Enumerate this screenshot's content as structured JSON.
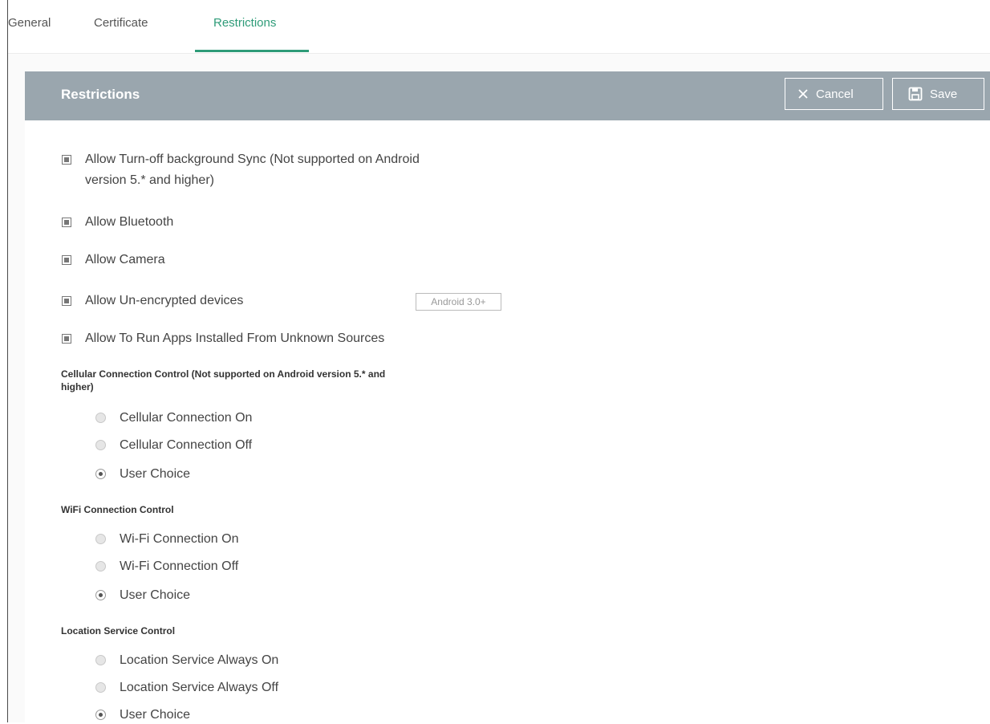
{
  "tabs": [
    {
      "label": "General"
    },
    {
      "label": "Certificate"
    },
    {
      "label": "Restrictions"
    }
  ],
  "panel": {
    "title": "Restrictions",
    "cancel_label": "Cancel",
    "save_label": "Save"
  },
  "checkboxes": [
    {
      "label_line1": "Allow Turn-off background Sync (Not supported on Android",
      "label_line2": "version 5.* and higher)",
      "checked": true
    },
    {
      "label": "Allow Bluetooth",
      "checked": true
    },
    {
      "label": "Allow Camera",
      "checked": true
    },
    {
      "label": "Allow Un-encrypted devices",
      "checked": true,
      "badge": "Android 3.0+"
    },
    {
      "label": "Allow To Run Apps Installed From Unknown Sources",
      "checked": true
    }
  ],
  "cellular": {
    "title_line1": "Cellular Connection Control (Not supported on Android version 5.* and",
    "title_line2": "higher)",
    "options": [
      "Cellular Connection On",
      "Cellular Connection Off",
      "User Choice"
    ],
    "selected": "User Choice"
  },
  "wifi": {
    "title": "WiFi Connection Control",
    "options": [
      "Wi-Fi Connection On",
      "Wi-Fi Connection Off",
      "User Choice"
    ],
    "selected": "User Choice"
  },
  "location": {
    "title": "Location Service Control",
    "options": [
      "Location Service Always On",
      "Location Service Always Off",
      "User Choice"
    ],
    "selected": "User Choice"
  },
  "colors": {
    "accent": "#2e9b78",
    "header_bg": "#9aa6ae"
  },
  "icons": {
    "cancel": "close-icon",
    "save": "floppy-disk-icon"
  }
}
